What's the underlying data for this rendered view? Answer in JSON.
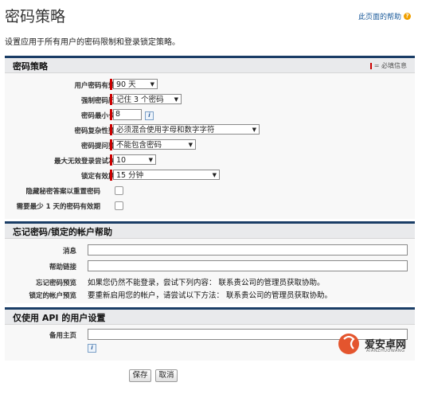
{
  "header": {
    "title": "密码策略",
    "help_link": "此页面的帮助",
    "description": "设置应用于所有用户的密码限制和登录锁定策略。"
  },
  "password_policy": {
    "section_title": "密码策略",
    "required_legend": "= 必填信息",
    "fields": {
      "expiry_label": "用户密码有效期",
      "expiry_value": "90 天",
      "history_label": "强制密码历史",
      "history_value": "记住 3 个密码",
      "min_length_label": "密码最小长度",
      "min_length_value": "8",
      "complexity_label": "密码复杂性要求",
      "complexity_value": "必须混合使用字母和数字字符",
      "question_label": "密码提问要求",
      "question_value": "不能包含密码",
      "max_attempts_label": "最大无效登录尝试次数",
      "max_attempts_value": "10",
      "lockout_label": "锁定有效期间",
      "lockout_value": "15 分钟",
      "hide_answer_label": "隐藏秘密答案以重置密码",
      "min_lifetime_label": "需要最少 1 天的密码有效期"
    }
  },
  "forgot_password": {
    "section_title": "忘记密码/锁定的帐户帮助",
    "message_label": "消息",
    "help_link_label": "帮助链接",
    "forgot_preview_label": "忘记密码预览",
    "forgot_preview_text": "如果您仍然不能登录，尝试下列内容： 联系贵公司的管理员获取协助。",
    "locked_preview_label": "锁定的帐户预览",
    "locked_preview_text": "要重新启用您的帐户，请尝试以下方法： 联系贵公司的管理员获取协助。"
  },
  "api_only": {
    "section_title": "仅使用 API 的用户设置",
    "alt_home_label": "备用主页"
  },
  "buttons": {
    "save": "保存",
    "cancel": "取消"
  },
  "watermark": {
    "text": "爱安卓网",
    "subtext": "AIANZHUOWANG"
  },
  "colors": {
    "accent": "#1a3d66",
    "required": "#cc0000"
  }
}
